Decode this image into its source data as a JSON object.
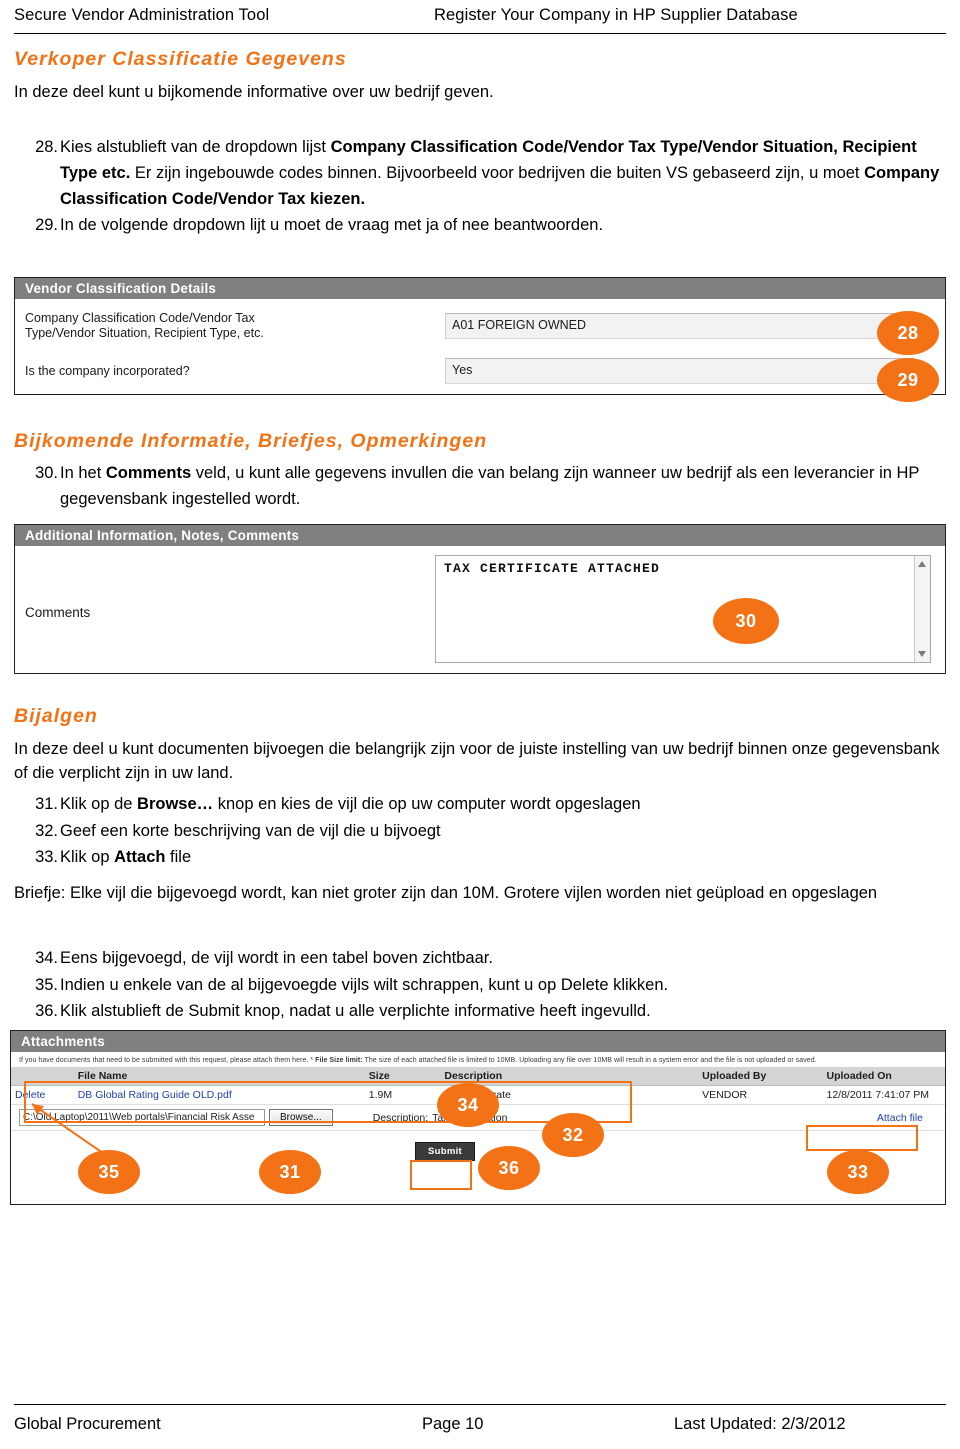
{
  "header": {
    "left_title": "Secure Vendor Administration Tool",
    "center_title": "Register Your Company in HP Supplier Database"
  },
  "sections": {
    "classification": {
      "heading": "Verkoper Classificatie Gegevens",
      "intro": "In deze deel kunt u bijkomende informative over uw bedrijf geven.",
      "steps": [
        {
          "num": "28.",
          "parts": [
            {
              "t": "Kies alstublieft  van de dropdown lijst ",
              "b": false
            },
            {
              "t": "Company Classification Code/Vendor Tax Type/Vendor Situation, Recipient Type etc.",
              "b": true
            },
            {
              "t": " Er zijn ingebouwde codes binnen. Bijvoorbeeld voor bedrijven die buiten VS gebaseerd zijn, u moet ",
              "b": false
            },
            {
              "t": "Company Classification Code/Vendor Tax kiezen.",
              "b": true
            }
          ]
        },
        {
          "num": "29.",
          "parts": [
            {
              "t": "In de volgende dropdown lijt u moet de vraag met ja of nee beantwoorden.",
              "b": false
            }
          ]
        }
      ]
    },
    "additional": {
      "heading": "Bijkomende Informatie, Briefjes, Opmerkingen",
      "steps": [
        {
          "num": "30.",
          "parts": [
            {
              "t": "In het ",
              "b": false
            },
            {
              "t": "Comments",
              "b": true
            },
            {
              "t": " veld, u kunt alle gegevens invullen die van belang zijn wanneer uw bedrijf als een leverancier in HP gegevensbank ingestelled wordt.",
              "b": false
            }
          ]
        }
      ]
    },
    "attachments": {
      "heading": "Bijalgen",
      "intro": "In deze deel u kunt documenten bijvoegen die belangrijk zijn voor de juiste instelling van uw bedrijf binnen onze gegevensbank of die verplicht zijn in uw land.",
      "steps_a": [
        {
          "num": "31.",
          "parts": [
            {
              "t": "Klik op de ",
              "b": false
            },
            {
              "t": "Browse…",
              "b": true
            },
            {
              "t": " knop en kies de vijl die op uw computer wordt opgeslagen",
              "b": false
            }
          ]
        },
        {
          "num": "32.",
          "parts": [
            {
              "t": "Geef een korte beschrijving van de vijl die u bijvoegt",
              "b": false
            }
          ]
        },
        {
          "num": "33.",
          "parts": [
            {
              "t": "Klik op ",
              "b": false
            },
            {
              "t": "Attach",
              "b": true
            },
            {
              "t": " file",
              "b": false
            }
          ]
        }
      ],
      "note_label": "Briefje:",
      "note_text": " Elke vijl die bijgevoegd wordt, kan niet groter zijn dan 10M. Grotere vijlen worden niet geüpload en opgeslagen",
      "steps_b": [
        {
          "num": "34.",
          "parts": [
            {
              "t": "Eens bijgevoegd, de vijl wordt in een tabel boven zichtbaar.",
              "b": false
            }
          ]
        },
        {
          "num": "35.",
          "parts": [
            {
              "t": "Indien u enkele van de al bijgevoegde vijls wilt schrappen, kunt u op Delete klikken.",
              "b": false
            }
          ]
        },
        {
          "num": "36.",
          "parts": [
            {
              "t": "Klik alstublieft de Submit knop, nadat u alle verplichte informative heeft ingevulld.",
              "b": false
            }
          ]
        }
      ]
    }
  },
  "panel_classification": {
    "title": "Vendor Classification Details",
    "row1_label_line1": "Company Classification Code/Vendor Tax",
    "row1_label_line2": "Type/Vendor Situation, Recipient Type, etc.",
    "row1_value": "A01 FOREIGN OWNED",
    "row2_label": "Is the company incorporated?",
    "row2_value": "Yes",
    "badge_28": "28",
    "badge_29": "29"
  },
  "panel_comments": {
    "title": "Additional Information, Notes, Comments",
    "label": "Comments",
    "value": "TAX CERTIFICATE ATTACHED",
    "badge_30": "30"
  },
  "panel_attachments": {
    "title": "Attachments",
    "note_pre": "If you have documents that need to be submitted with this request, please attach them here. * ",
    "note_bold": "File Size limit:",
    "note_post": " The size of each attached file is limited to 10MB. Uploading any file over 10MB will result in a system error and the file is not uploaded or saved.",
    "columns": [
      "",
      "File Name",
      "Size",
      "Description",
      "Uploaded By",
      "Uploaded On"
    ],
    "rows": [
      {
        "delete": "Delete",
        "file_name": "DB Global Rating Guide OLD.pdf",
        "size": "1.9M",
        "description": "Tax Certificate",
        "uploaded_by": "VENDOR",
        "uploaded_on": "12/8/2011 7:41:07 PM"
      }
    ],
    "path_value": "C:\\Old Laptop\\2011\\Web portals\\Financial Risk Asse",
    "browse_label": "Browse...",
    "description_label": "Description:",
    "description_value": "Tax Registration",
    "attach_file_label": "Attach file",
    "submit_label": "Submit",
    "badge_31": "31",
    "badge_32": "32",
    "badge_33": "33",
    "badge_34": "34",
    "badge_35": "35",
    "badge_36": "36"
  },
  "footer": {
    "left": "Global Procurement",
    "center": "Page 10",
    "right": "Last Updated: 2/3/2012"
  },
  "colors": {
    "accent_orange": "#F47216",
    "panel_header_gray": "#808080",
    "link_blue": "#1F3FA8"
  }
}
